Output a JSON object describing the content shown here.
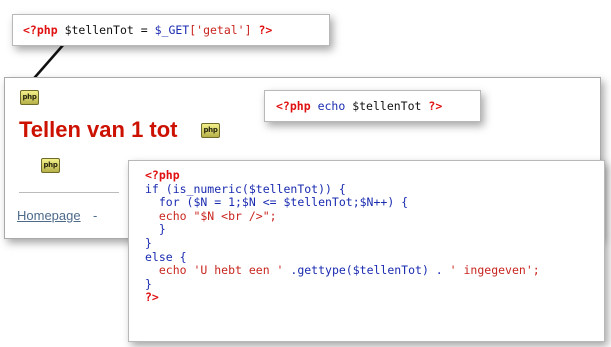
{
  "top_callout": {
    "open_tag": "<?php",
    "variable": "$tellenTot",
    "assign": " = ",
    "superglobal": "$_GET",
    "key": "['getal']",
    "close_tag": "?>"
  },
  "browser": {
    "badge_text": "php",
    "heading": "Tellen van 1 tot",
    "homepage_link": "Homepage",
    "separator": "-"
  },
  "echo_callout": {
    "open_tag": "<?php",
    "keyword": "echo",
    "variable": "$tellenTot",
    "close_tag": "?>"
  },
  "code_callout": {
    "open_tag": "<?php",
    "line_if": "if (is_numeric($tellenTot)) {",
    "line_for": "  for ($N = 1;$N <= $tellenTot;$N++) {",
    "line_echo_n": "  echo \"$N <br />\";",
    "line_inner_close": "  }",
    "line_if_close": "}",
    "line_else": "else {",
    "line_echo_else_start": "  echo 'U hebt een '",
    "line_echo_else_mid": " .gettype($tellenTot) . ",
    "line_echo_else_end": "' ingegeven';",
    "line_close_brace": "}",
    "close_tag": "?>"
  }
}
